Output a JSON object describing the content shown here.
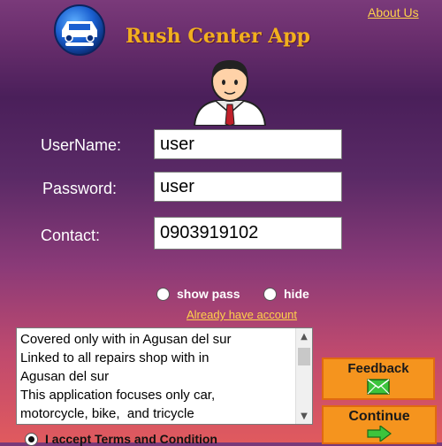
{
  "header": {
    "about_label": "About Us",
    "app_title": "Rush Center App"
  },
  "form": {
    "username_label": "UserName:",
    "username_value": "user",
    "password_label": "Password:",
    "password_value": "user",
    "contact_label": "Contact:",
    "contact_value": "0903919102",
    "show_pass_label": "show pass",
    "hide_label": "hide",
    "already_account_label": "Already have account"
  },
  "terms": {
    "text": "Covered only with in Agusan del sur\nLinked to all repairs shop with in\nAgusan del sur\nThis application focuses only car,\nmotorcycle, bike,  and tricycle",
    "accept_label": "I accept Terms and Condition"
  },
  "buttons": {
    "feedback_label": "Feedback",
    "continue_label": "Continue"
  },
  "colors": {
    "accent_title": "#f2b01e",
    "link": "#ffd24a",
    "button_bg": "#f5941e"
  }
}
